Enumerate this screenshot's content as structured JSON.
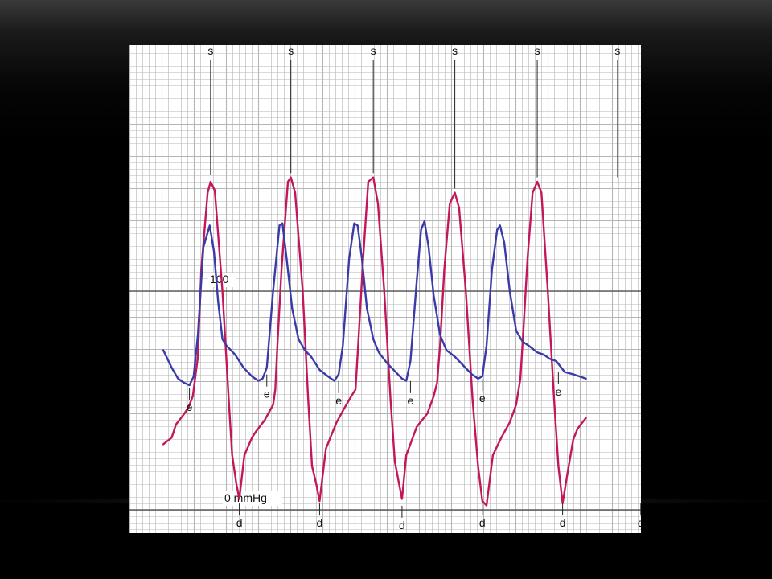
{
  "chart_data": {
    "type": "line",
    "ylim": [
      0,
      160
    ],
    "reference_lines": [
      {
        "value": 100,
        "label": "100"
      },
      {
        "value": 0,
        "label": "0 mmHg"
      }
    ],
    "colors": {
      "red_trace": "#c2185b",
      "blue_trace": "#3a3aa8",
      "grid": "#b5b5b5",
      "reference": "#444444"
    },
    "series": [
      {
        "points": [
          [
            0.0,
            30
          ],
          [
            0.02,
            33
          ],
          [
            0.03,
            39
          ],
          [
            0.05,
            44
          ],
          [
            0.06,
            47
          ],
          [
            0.07,
            52
          ],
          [
            0.082,
            70
          ],
          [
            0.09,
            110
          ],
          [
            0.105,
            145
          ],
          [
            0.112,
            150
          ],
          [
            0.122,
            146
          ],
          [
            0.14,
            100
          ],
          [
            0.155,
            50
          ],
          [
            0.163,
            25
          ],
          [
            0.173,
            12
          ],
          [
            0.18,
            5
          ],
          [
            0.192,
            25
          ],
          [
            0.21,
            33
          ],
          [
            0.22,
            36
          ],
          [
            0.24,
            41
          ],
          [
            0.26,
            48
          ],
          [
            0.265,
            55
          ],
          [
            0.27,
            75
          ],
          [
            0.28,
            110
          ],
          [
            0.295,
            150
          ],
          [
            0.302,
            152
          ],
          [
            0.312,
            145
          ],
          [
            0.33,
            100
          ],
          [
            0.343,
            50
          ],
          [
            0.352,
            20
          ],
          [
            0.362,
            12
          ],
          [
            0.37,
            4
          ],
          [
            0.385,
            28
          ],
          [
            0.41,
            40
          ],
          [
            0.43,
            47
          ],
          [
            0.445,
            52
          ],
          [
            0.455,
            55
          ],
          [
            0.462,
            78
          ],
          [
            0.473,
            115
          ],
          [
            0.485,
            150
          ],
          [
            0.497,
            152
          ],
          [
            0.508,
            140
          ],
          [
            0.523,
            100
          ],
          [
            0.538,
            50
          ],
          [
            0.548,
            22
          ],
          [
            0.558,
            12
          ],
          [
            0.565,
            5
          ],
          [
            0.575,
            25
          ],
          [
            0.6,
            38
          ],
          [
            0.625,
            44
          ],
          [
            0.64,
            52
          ],
          [
            0.648,
            58
          ],
          [
            0.655,
            75
          ],
          [
            0.665,
            110
          ],
          [
            0.678,
            140
          ],
          [
            0.69,
            145
          ],
          [
            0.7,
            138
          ],
          [
            0.716,
            100
          ],
          [
            0.732,
            50
          ],
          [
            0.745,
            20
          ],
          [
            0.755,
            4
          ],
          [
            0.765,
            2
          ],
          [
            0.78,
            25
          ],
          [
            0.8,
            33
          ],
          [
            0.82,
            40
          ],
          [
            0.835,
            48
          ],
          [
            0.845,
            60
          ],
          [
            0.853,
            85
          ],
          [
            0.862,
            115
          ],
          [
            0.874,
            145
          ],
          [
            0.885,
            150
          ],
          [
            0.895,
            145
          ],
          [
            0.91,
            100
          ],
          [
            0.925,
            50
          ],
          [
            0.935,
            20
          ],
          [
            0.945,
            3
          ],
          [
            0.955,
            15
          ],
          [
            0.97,
            32
          ],
          [
            0.98,
            37
          ],
          [
            1.0,
            42
          ]
        ]
      },
      {
        "points": [
          [
            0.0,
            73
          ],
          [
            0.02,
            65
          ],
          [
            0.035,
            60
          ],
          [
            0.05,
            58
          ],
          [
            0.062,
            57
          ],
          [
            0.072,
            61
          ],
          [
            0.082,
            80
          ],
          [
            0.095,
            120
          ],
          [
            0.11,
            130
          ],
          [
            0.12,
            118
          ],
          [
            0.13,
            95
          ],
          [
            0.14,
            78
          ],
          [
            0.15,
            75
          ],
          [
            0.17,
            71
          ],
          [
            0.19,
            65
          ],
          [
            0.21,
            61
          ],
          [
            0.225,
            59
          ],
          [
            0.235,
            60
          ],
          [
            0.245,
            65
          ],
          [
            0.26,
            100
          ],
          [
            0.275,
            130
          ],
          [
            0.282,
            131
          ],
          [
            0.292,
            115
          ],
          [
            0.305,
            92
          ],
          [
            0.32,
            78
          ],
          [
            0.335,
            73
          ],
          [
            0.35,
            70
          ],
          [
            0.37,
            64
          ],
          [
            0.39,
            61
          ],
          [
            0.405,
            59
          ],
          [
            0.415,
            62
          ],
          [
            0.425,
            75
          ],
          [
            0.44,
            115
          ],
          [
            0.452,
            131
          ],
          [
            0.46,
            130
          ],
          [
            0.47,
            115
          ],
          [
            0.482,
            92
          ],
          [
            0.497,
            78
          ],
          [
            0.51,
            72
          ],
          [
            0.53,
            67
          ],
          [
            0.55,
            63
          ],
          [
            0.565,
            60
          ],
          [
            0.575,
            59
          ],
          [
            0.585,
            68
          ],
          [
            0.6,
            105
          ],
          [
            0.61,
            128
          ],
          [
            0.618,
            132
          ],
          [
            0.628,
            120
          ],
          [
            0.64,
            98
          ],
          [
            0.655,
            80
          ],
          [
            0.67,
            73
          ],
          [
            0.69,
            70
          ],
          [
            0.71,
            66
          ],
          [
            0.73,
            62
          ],
          [
            0.745,
            60
          ],
          [
            0.755,
            61
          ],
          [
            0.765,
            75
          ],
          [
            0.778,
            110
          ],
          [
            0.79,
            128
          ],
          [
            0.797,
            130
          ],
          [
            0.807,
            122
          ],
          [
            0.82,
            100
          ],
          [
            0.835,
            82
          ],
          [
            0.85,
            77
          ],
          [
            0.865,
            75
          ],
          [
            0.885,
            72
          ],
          [
            0.9,
            71
          ],
          [
            0.915,
            69
          ],
          [
            0.93,
            68
          ],
          [
            0.95,
            63
          ],
          [
            0.97,
            62
          ],
          [
            1.0,
            60
          ]
        ]
      }
    ],
    "annotations": [
      {
        "text": "s",
        "x": 0.112,
        "y": 151.5,
        "dir": "up"
      },
      {
        "text": "s",
        "x": 0.302,
        "y": 152.5,
        "dir": "up"
      },
      {
        "text": "s",
        "x": 0.497,
        "y": 152.5,
        "dir": "up"
      },
      {
        "text": "s",
        "x": 0.69,
        "y": 145.5,
        "dir": "up"
      },
      {
        "text": "s",
        "x": 0.885,
        "y": 150.5,
        "dir": "up"
      },
      {
        "text": "s",
        "x": 1.075,
        "y": 150.5,
        "dir": "up"
      },
      {
        "text": "e",
        "x": 0.062,
        "y": 57,
        "dir": "down"
      },
      {
        "text": "e",
        "x": 0.245,
        "y": 63,
        "dir": "down"
      },
      {
        "text": "e",
        "x": 0.415,
        "y": 60,
        "dir": "down"
      },
      {
        "text": "e",
        "x": 0.585,
        "y": 60,
        "dir": "down"
      },
      {
        "text": "e",
        "x": 0.755,
        "y": 61,
        "dir": "down"
      },
      {
        "text": "e",
        "x": 0.935,
        "y": 64,
        "dir": "down"
      },
      {
        "text": "d",
        "x": 0.18,
        "y": 4,
        "dir": "down"
      },
      {
        "text": "d",
        "x": 0.37,
        "y": 4,
        "dir": "down"
      },
      {
        "text": "d",
        "x": 0.565,
        "y": 3,
        "dir": "down"
      },
      {
        "text": "d",
        "x": 0.755,
        "y": 4,
        "dir": "down"
      },
      {
        "text": "d",
        "x": 0.945,
        "y": 4,
        "dir": "down"
      },
      {
        "text": "d",
        "x": 1.13,
        "y": 4,
        "dir": "down"
      }
    ]
  }
}
